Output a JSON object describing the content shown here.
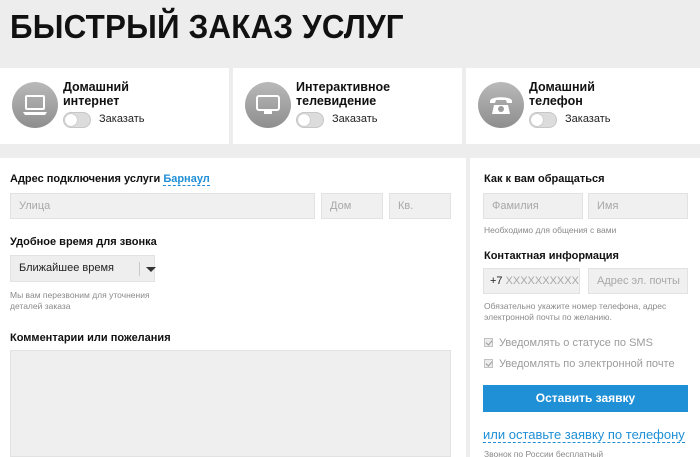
{
  "page": {
    "title": "БЫСТРЫЙ ЗАКАЗ УСЛУГ"
  },
  "services": [
    {
      "label": "Домашний интернет",
      "toggle_label": "Заказать",
      "icon": "laptop-icon"
    },
    {
      "label": "Интерактивное телевидение",
      "toggle_label": "Заказать",
      "icon": "tv-icon"
    },
    {
      "label": "Домашний телефон",
      "toggle_label": "Заказать",
      "icon": "telephone-icon"
    }
  ],
  "address": {
    "label": "Адрес подключения услуги",
    "city": "Барнаул",
    "street_placeholder": "Улица",
    "house_placeholder": "Дом",
    "apartment_placeholder": "Кв."
  },
  "call_time": {
    "label": "Удобное время для звонка",
    "selected": "Ближайшее время",
    "hint": "Мы вам перезвоним для уточнения деталей заказа"
  },
  "comments": {
    "label": "Комментарии или пожелания"
  },
  "contact_name": {
    "label": "Как к вам обращаться",
    "surname_placeholder": "Фамилия",
    "name_placeholder": "Имя",
    "hint": "Необходимо для общения с вами"
  },
  "contact_info": {
    "label": "Контактная информация",
    "phone_prefix": "+7",
    "phone_placeholder": "XXXXXXXXXX",
    "email_placeholder": "Адрес эл. почты",
    "hint": "Обязательно укажите номер телефона, адрес электронной почты по желанию."
  },
  "notifications": {
    "sms": "Уведомлять о статусе по SMS",
    "email": "Уведомлять по электронной почте"
  },
  "actions": {
    "submit": "Оставить заявку",
    "phone_link": "или оставьте заявку по телефону",
    "phone_note": "Звонок по России бесплатный"
  },
  "colors": {
    "accent": "#1f8fd6",
    "background": "#ededed"
  }
}
